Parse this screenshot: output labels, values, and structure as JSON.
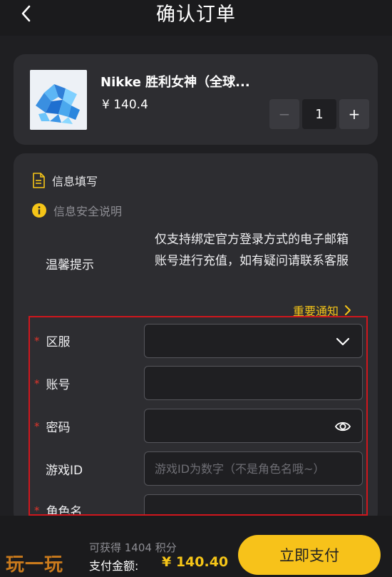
{
  "header": {
    "title": "确认订单"
  },
  "product": {
    "name": "Nikke 胜利女神（全球...",
    "price": "¥ 140.4",
    "quantity": "1",
    "minus_label": "−",
    "plus_label": "+"
  },
  "form": {
    "info_title": "信息填写",
    "safety_note": "信息安全说明",
    "tip_label": "温馨提示",
    "tip_text": "仅支持绑定官方登录方式的电子邮箱账号进行充值，如有疑问请联系客服",
    "notice_link": "重要通知",
    "required_mark": "*",
    "fields": {
      "region": {
        "label": "区服",
        "value": ""
      },
      "account": {
        "label": "账号",
        "value": ""
      },
      "password": {
        "label": "密码",
        "value": ""
      },
      "game_id": {
        "label": "游戏ID",
        "placeholder": "游戏ID为数字（不是角色名哦~）"
      },
      "role_name": {
        "label": "角色名",
        "value": ""
      }
    }
  },
  "footer": {
    "points": "可获得 1404 积分",
    "total_label": "支付金额:",
    "total_amount": "¥ 140.40",
    "pay_button": "立即支付",
    "watermark": "玩一玩"
  },
  "colors": {
    "accent": "#f7c21a",
    "required": "#e0352b",
    "highlight_border": "#d0161d",
    "background": "#1f1f22",
    "card": "#2d2d31"
  }
}
